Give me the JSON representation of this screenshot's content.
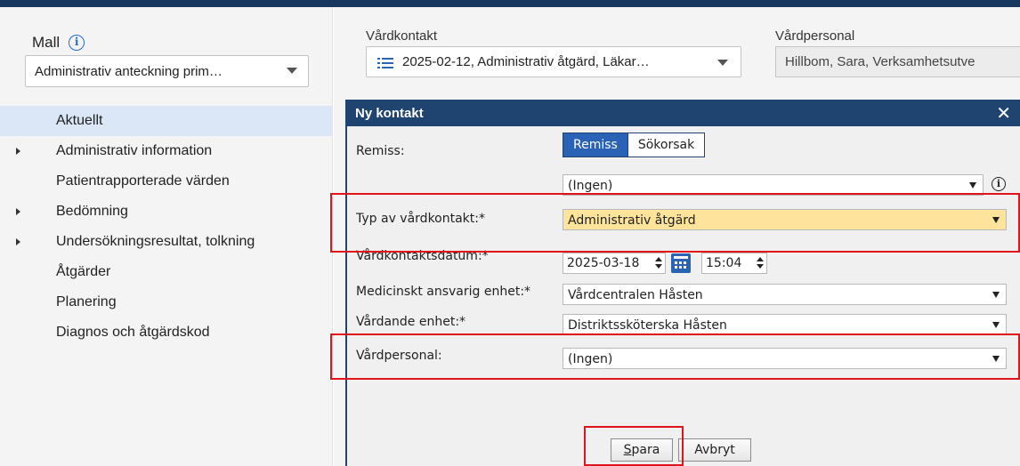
{
  "sidebar": {
    "title": "Mall",
    "template_select": "Administrativ anteckning prim…",
    "items": [
      {
        "label": "Aktuellt"
      },
      {
        "label": "Administrativ information"
      },
      {
        "label": "Patientrapporterade värden"
      },
      {
        "label": "Bedömning"
      },
      {
        "label": "Undersökningsresultat, tolkning"
      },
      {
        "label": "Åtgärder"
      },
      {
        "label": "Planering"
      },
      {
        "label": "Diagnos och åtgärdskod"
      }
    ]
  },
  "main": {
    "vardkontakt_label": "Vårdkontakt",
    "vardkontakt_value": "2025-02-12, Administrativ åtgärd, Läkar…",
    "vardpersonal_label": "Vårdpersonal",
    "vardpersonal_value": "Hillbom, Sara, Verksamhetsutve"
  },
  "dialog": {
    "title": "Ny kontakt",
    "close": "✕",
    "remiss_label": "Remiss:",
    "toggle": [
      "Remiss",
      "Sökorsak"
    ],
    "remiss_value": "(Ingen)",
    "typ_label": "Typ av vårdkontakt:*",
    "typ_value": "Administrativ åtgärd",
    "datum_label": "Vårdkontaktsdatum:*",
    "datum_value": "2025-03-18",
    "time_value": "15:04",
    "medansvar_label": "Medicinskt ansvarig enhet:*",
    "medansvar_value": "Vårdcentralen Håsten",
    "vardande_label": "Vårdande enhet:*",
    "vardande_value": "Distriktssköterska Håsten",
    "vardpersonal_label": "Vårdpersonal:",
    "vardpersonal_value": "(Ingen)",
    "save_first": "S",
    "save_rest": "para",
    "cancel": "Avbryt"
  },
  "colors": {
    "title_bar": "#1f4470",
    "highlight_field": "#fde49a",
    "annotation_red": "#e0141a",
    "active_nav": "#dbe7f6"
  }
}
